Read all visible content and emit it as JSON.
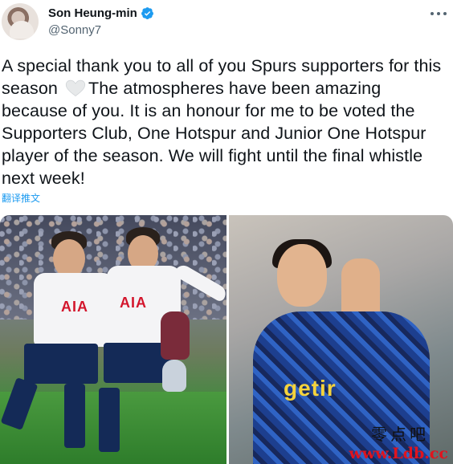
{
  "tweet": {
    "author_name": "Son Heung-min",
    "author_handle": "@Sonny7",
    "text_before_emoji": "A special thank you to all of you Spurs supporters for this season ",
    "text_after_emoji": "The atmospheres have been amazing because of you. It is an honour for me to be voted the Supporters Club, One Hotspur and Junior One Hotspur player of the season. We will fight until the final whistle next week!",
    "emoji": "white-heart-icon",
    "translate_label": "翻译推文"
  },
  "media": {
    "left_photo": {
      "jersey_text_1": "AIA",
      "jersey_text_2": "AIA"
    },
    "right_photo": {
      "jersey_text": "getir"
    }
  },
  "watermark": {
    "site_name": "零点吧",
    "site_url": "www.Ldb.cc"
  },
  "colors": {
    "link_blue": "#1d9bf0",
    "verified_blue": "#1d9bf0",
    "muted_gray": "#536471"
  }
}
